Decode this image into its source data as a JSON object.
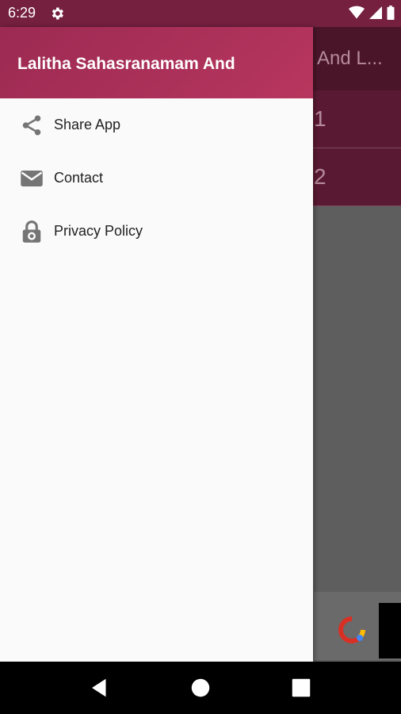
{
  "status_bar": {
    "time": "6:29"
  },
  "background_app": {
    "title": "And L...",
    "rows": [
      "1",
      "2"
    ]
  },
  "drawer": {
    "title": "Lalitha Sahasranamam And",
    "items": [
      {
        "label": "Share App",
        "icon": "share-icon"
      },
      {
        "label": "Contact",
        "icon": "mail-icon"
      },
      {
        "label": "Privacy Policy",
        "icon": "lock-icon"
      }
    ]
  },
  "colors": {
    "status_bar": "#75203f",
    "drawer_header": "#b7365f",
    "toolbar_dim": "#4b1529"
  }
}
